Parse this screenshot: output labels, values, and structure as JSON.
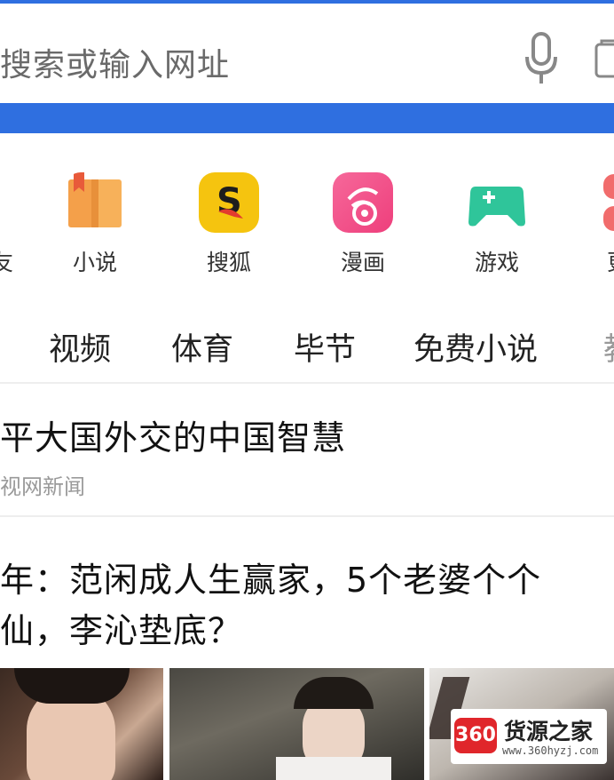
{
  "search": {
    "placeholder": "搜索或输入网址",
    "mic_icon": "microphone-icon",
    "tabs_icon": "tabs-icon"
  },
  "colors": {
    "accent": "#2f6fe0"
  },
  "shortcuts": {
    "left_partial_label": "友",
    "right_partial_label": "更",
    "items": [
      {
        "label": "小说",
        "icon": "novel-book-icon",
        "color": "#f7a23c"
      },
      {
        "label": "搜狐",
        "icon": "sohu-logo-icon",
        "color": "#f5c40f"
      },
      {
        "label": "漫画",
        "icon": "comic-icon",
        "color": "#f0588a"
      },
      {
        "label": "游戏",
        "icon": "gamepad-icon",
        "color": "#2fc59a"
      }
    ]
  },
  "channels": {
    "tabs": [
      "视频",
      "体育",
      "毕节",
      "免费小说"
    ],
    "partial_tab": "教"
  },
  "news": [
    {
      "title": "平大国外交的中国智慧",
      "source": "视网新闻"
    },
    {
      "title_line1": "年：范闲成人生赢家，5个老婆个个",
      "title_line2": "仙，李沁垫底？"
    }
  ],
  "watermark": {
    "logo_text": "360",
    "title": "货源之家",
    "url": "www.360hyzj.com"
  }
}
